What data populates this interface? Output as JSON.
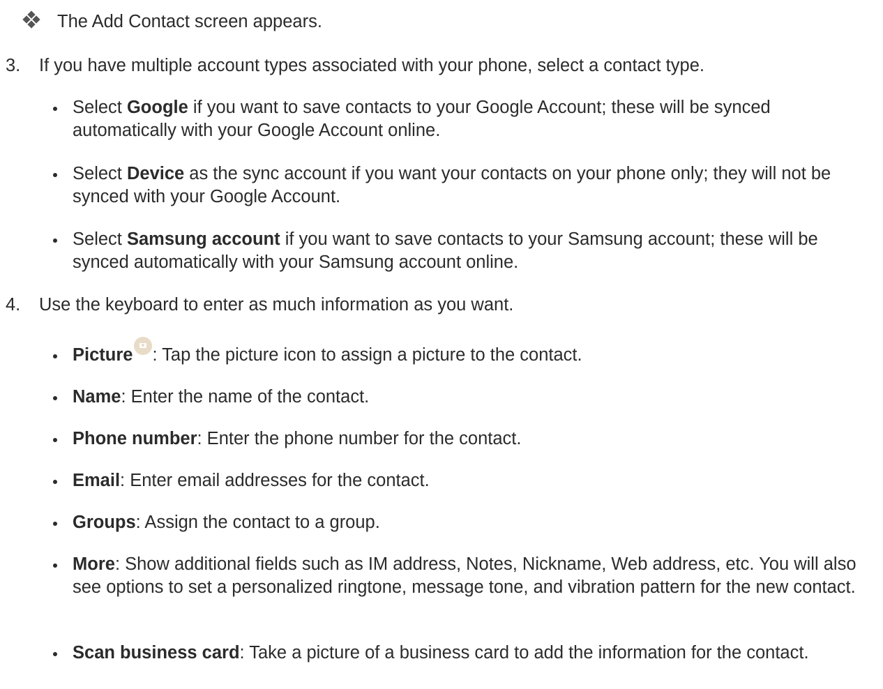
{
  "result": {
    "text": "The Add Contact screen appears."
  },
  "step3": {
    "number": "3.",
    "text": "If you have multiple account types associated with your phone, select a contact type.",
    "bullets": [
      {
        "bold": "Google",
        "rest": " if you want to save contacts to your Google Account; these will be synced automatically with your Google Account online."
      },
      {
        "bold": "Device",
        "rest": " as the sync account if you want your contacts on your phone only; they will not be synced with your Google Account."
      },
      {
        "bold": "Samsung account",
        "rest": " if you want to save contacts to your Samsung account; these will be synced automatically with your Samsung account online."
      }
    ],
    "select_prefix": "Select "
  },
  "step4": {
    "number": "4.",
    "text": "Use the keyboard to enter as much information as you want.",
    "bullets": [
      {
        "bold": "Picture",
        "rest": ": Tap the picture icon to assign a picture to the contact."
      },
      {
        "bold": "Name",
        "rest": ": Enter the name of the contact."
      },
      {
        "bold": "Phone number",
        "rest": ": Enter the phone number for the contact."
      },
      {
        "bold": "Email",
        "rest": ": Enter email addresses for the contact."
      },
      {
        "bold": "Groups",
        "rest": ": Assign the contact to a group."
      },
      {
        "bold": "More",
        "rest": ": Show additional fields such as IM address, Notes, Nickname, Web address, etc. You will also see options to set a personalized ringtone, message tone, and vibration pattern for the new contact."
      },
      {
        "bold": "Scan business card",
        "rest": ": Take a picture of a business card to add the information for the contact."
      }
    ]
  }
}
